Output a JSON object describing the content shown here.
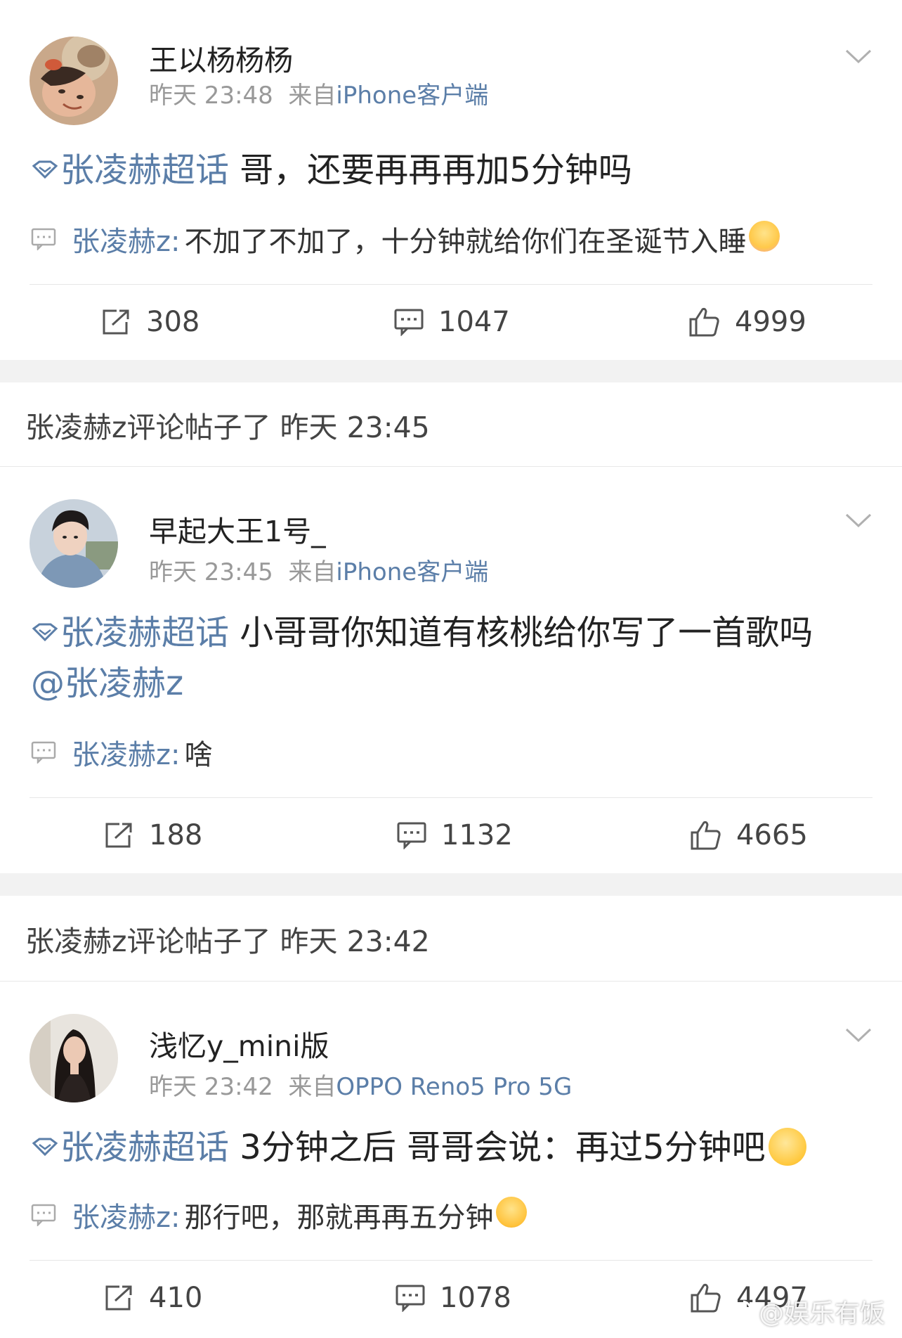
{
  "posts": [
    {
      "user": "王以杨杨杨",
      "time": "昨天 23:48",
      "from_label": "来自",
      "source": "iPhone客户端",
      "topic": "张凌赫超话",
      "text": " 哥，还要再再再加5分钟吗",
      "reply_author": "张凌赫z:",
      "reply_text": "不加了不加了，十分钟就给你们在圣诞节入睡",
      "reposts": "308",
      "comments": "1047",
      "likes": "4999"
    },
    {
      "user": "早起大王1号_",
      "time": "昨天 23:45",
      "from_label": "来自",
      "source": "iPhone客户端",
      "topic": "张凌赫超话",
      "text": " 小哥哥你知道有核桃给你写了一首歌吗",
      "mention": "@张凌赫z",
      "reply_author": "张凌赫z:",
      "reply_text": "啥",
      "reposts": "188",
      "comments": "1132",
      "likes": "4665"
    },
    {
      "user": "浅忆y_mini版",
      "time": "昨天 23:42",
      "from_label": "来自",
      "source": "OPPO Reno5 Pro 5G",
      "topic": "张凌赫超话",
      "text": " 3分钟之后 哥哥会说：再过5分钟吧",
      "reply_author": "张凌赫z:",
      "reply_text": "那行吧，那就再再五分钟",
      "reposts": "410",
      "comments": "1078",
      "likes": "4497"
    }
  ],
  "separators": [
    "张凌赫z评论帖子了 昨天 23:45",
    "张凌赫z评论帖子了 昨天 23:42"
  ],
  "watermark": "@娱乐有饭",
  "colors": {
    "link": "#5b7ea8",
    "meta": "#999999",
    "background": "#f2f2f2"
  }
}
